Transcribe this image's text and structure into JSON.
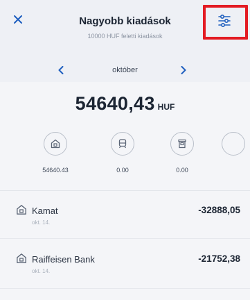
{
  "header": {
    "title": "Nagyobb kiadások",
    "subtitle": "10000 HUF feletti kiadások",
    "close_icon": "close-icon",
    "filter_icon": "sliders-icon",
    "highlight_color": "#e31b23",
    "accent_color": "#1f5fbf"
  },
  "month_nav": {
    "label": "október",
    "prev_icon": "chevron-left-icon",
    "next_icon": "chevron-right-icon"
  },
  "total": {
    "value": "54640,43",
    "currency": "HUF"
  },
  "categories": [
    {
      "icon": "house-icon",
      "value": "54640.43"
    },
    {
      "icon": "train-icon",
      "value": "0.00"
    },
    {
      "icon": "trash-icon",
      "value": "0.00"
    }
  ],
  "transactions": [
    {
      "icon": "house-icon",
      "name": "Kamat",
      "date": "okt. 14.",
      "amount": "-32888,05"
    },
    {
      "icon": "house-icon",
      "name": "Raiffeisen Bank",
      "date": "okt. 14.",
      "amount": "-21752,38"
    }
  ]
}
